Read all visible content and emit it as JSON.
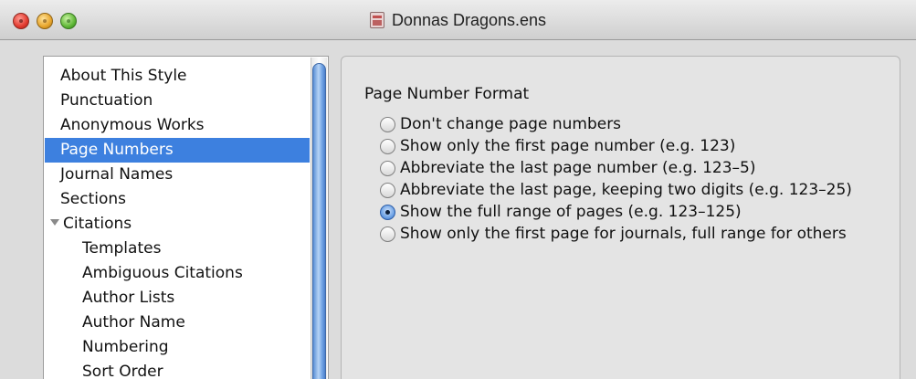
{
  "window": {
    "title": "Donnas Dragons.ens",
    "document_icon": "endnote-style-document-icon"
  },
  "sidebar": {
    "items": [
      {
        "label": "About This Style",
        "selected": false,
        "level": 0
      },
      {
        "label": "Punctuation",
        "selected": false,
        "level": 0
      },
      {
        "label": "Anonymous Works",
        "selected": false,
        "level": 0
      },
      {
        "label": "Page Numbers",
        "selected": true,
        "level": 0
      },
      {
        "label": "Journal Names",
        "selected": false,
        "level": 0
      },
      {
        "label": "Sections",
        "selected": false,
        "level": 0
      },
      {
        "label": "Citations",
        "selected": false,
        "level": 0,
        "expanded": true
      },
      {
        "label": "Templates",
        "selected": false,
        "level": 1
      },
      {
        "label": "Ambiguous Citations",
        "selected": false,
        "level": 1
      },
      {
        "label": "Author Lists",
        "selected": false,
        "level": 1
      },
      {
        "label": "Author Name",
        "selected": false,
        "level": 1
      },
      {
        "label": "Numbering",
        "selected": false,
        "level": 1
      },
      {
        "label": "Sort Order",
        "selected": false,
        "level": 1
      }
    ],
    "selection_color": "#3d80df"
  },
  "page_number_format": {
    "heading": "Page Number Format",
    "options": [
      {
        "label": "Don't change page numbers",
        "checked": false
      },
      {
        "label": "Show only the first page number (e.g. 123)",
        "checked": false
      },
      {
        "label": "Abbreviate the last page number (e.g. 123–5)",
        "checked": false
      },
      {
        "label": "Abbreviate the last page, keeping two digits (e.g. 123–25)",
        "checked": false
      },
      {
        "label": "Show the full range of pages (e.g. 123–125)",
        "checked": true
      },
      {
        "label": "Show only the first page for journals, full range for others",
        "checked": false
      }
    ]
  }
}
